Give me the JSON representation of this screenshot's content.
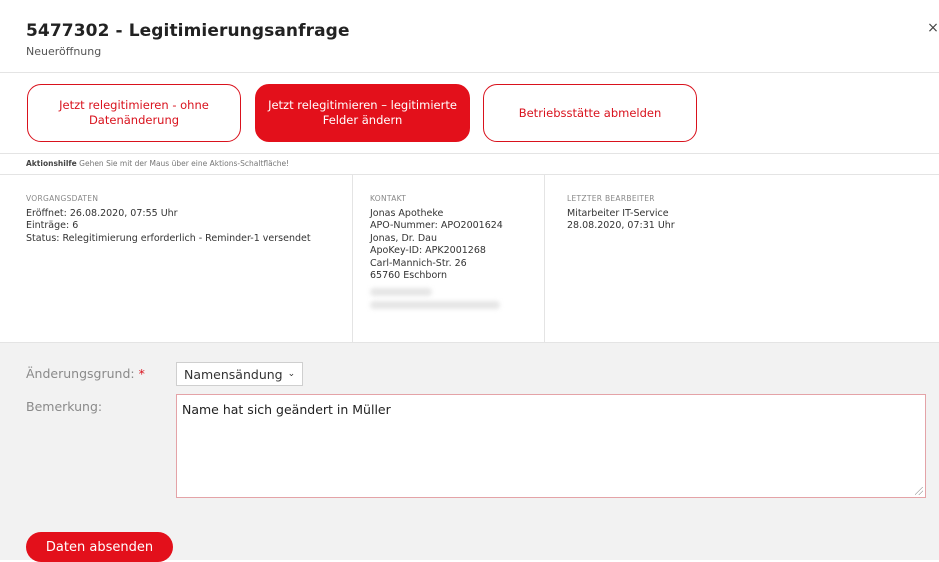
{
  "header": {
    "title": "5477302 - Legitimierungsanfrage",
    "subtitle": "Neueröffnung",
    "close_symbol": "×"
  },
  "actions": {
    "btn1": "Jetzt relegitimieren - ohne Datenänderung",
    "btn2": "Jetzt relegitimieren – legitimierte Felder ändern",
    "btn3": "Betriebsstätte abmelden"
  },
  "hint": {
    "label": "Aktionshilfe",
    "text": "Gehen Sie mit der Maus über eine Aktions-Schaltfläche!"
  },
  "vorgangsdaten": {
    "heading": "VORGANGSDATEN",
    "opened": "Eröffnet: 26.08.2020, 07:55 Uhr",
    "entries": "Einträge: 6",
    "status": "Status: Relegitimierung erforderlich - Reminder-1 versendet"
  },
  "kontakt": {
    "heading": "KONTAKT",
    "lines": [
      "Jonas Apotheke",
      "APO-Nummer: APO2001624",
      "Jonas, Dr. Dau",
      "ApoKey-ID: APK2001268",
      "Carl-Mannich-Str. 26",
      "65760 Eschborn"
    ]
  },
  "bearbeiter": {
    "heading": "LETZTER BEARBEITER",
    "name": "Mitarbeiter IT-Service",
    "date": "28.08.2020, 07:31 Uhr"
  },
  "form": {
    "reason_label": "Änderungsgrund:",
    "required_mark": "*",
    "reason_value": "Namensändung",
    "remark_label": "Bemerkung:",
    "remark_value": "Name hat sich geändert in Müller",
    "submit_label": "Daten absenden"
  },
  "colors": {
    "accent": "#e3101b",
    "form_bg": "#f2f2f2"
  }
}
